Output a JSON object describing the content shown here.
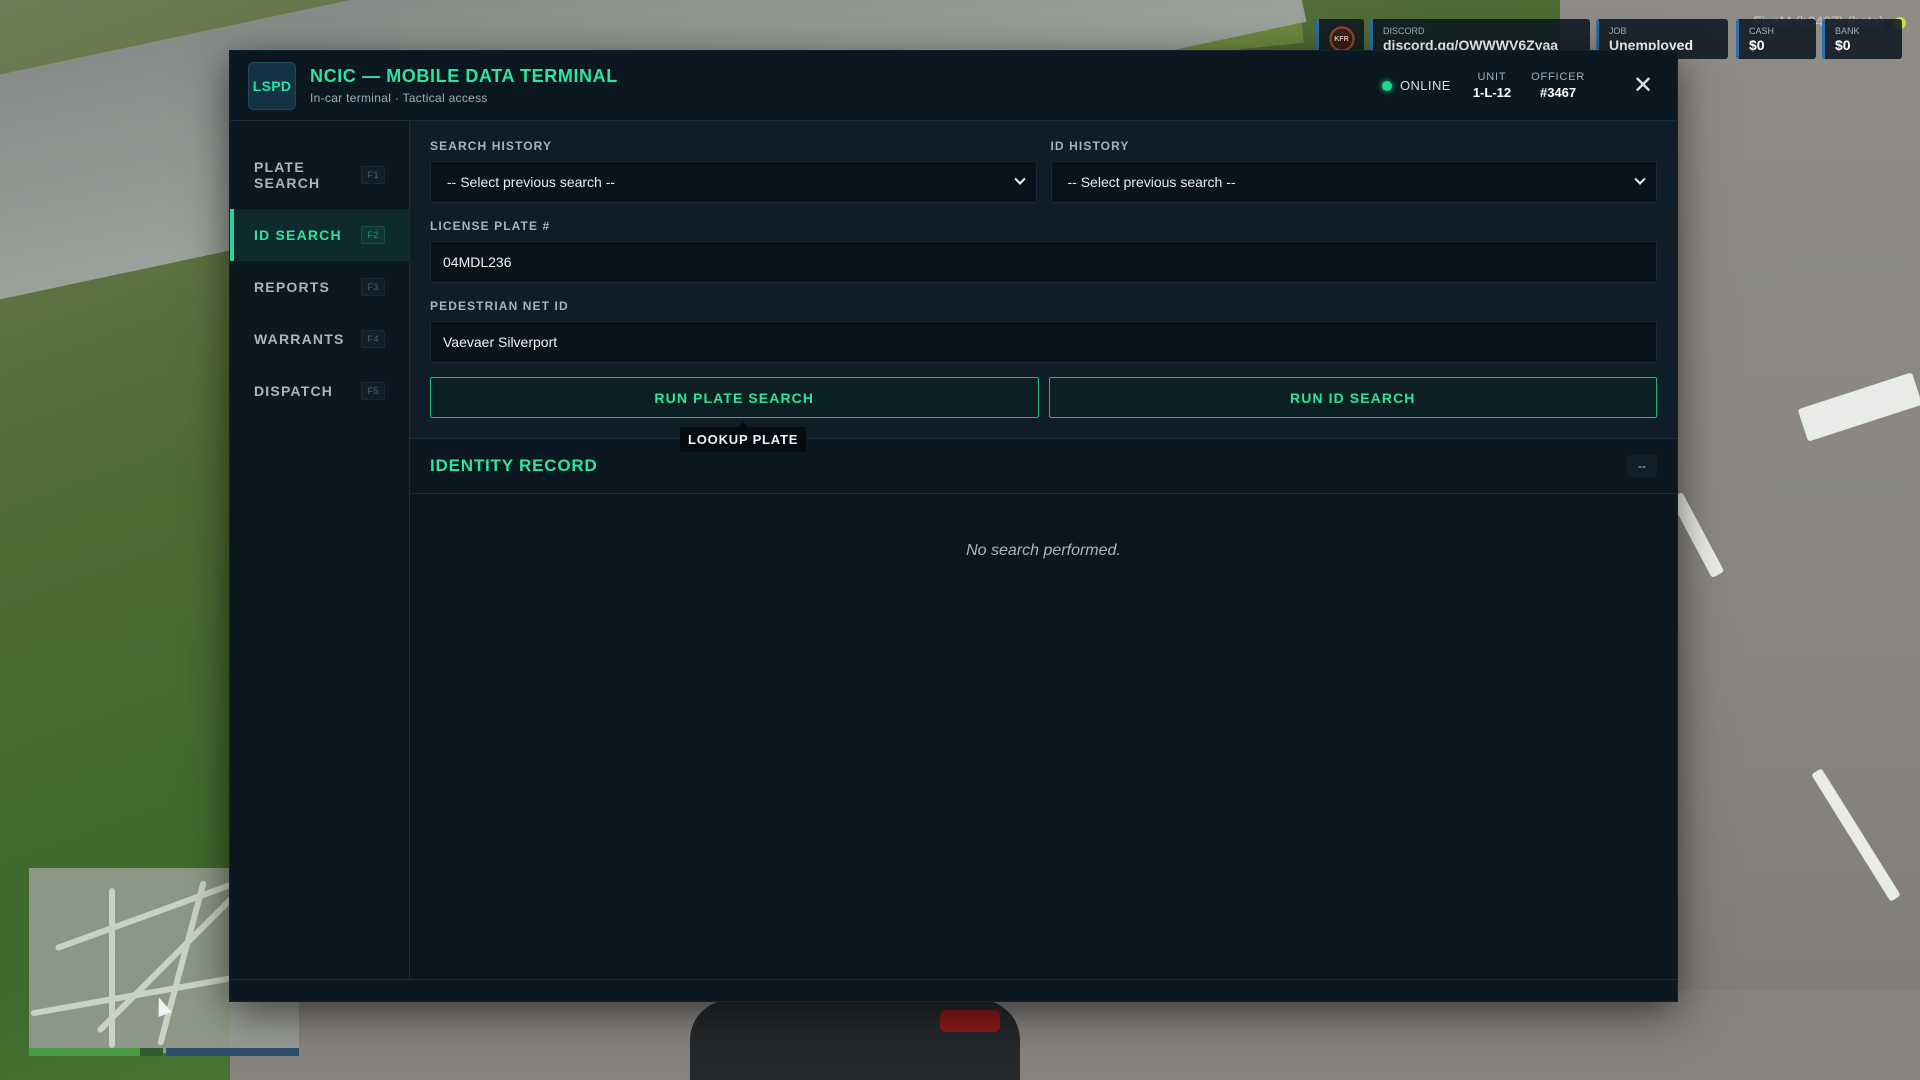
{
  "hud": {
    "logo_text": "KFR",
    "discord": {
      "label": "DISCORD",
      "value": "discord.gg/QWWWV6Zyaa"
    },
    "job": {
      "label": "JOB",
      "value": "Unemployed"
    },
    "cash": {
      "label": "CASH",
      "value": "$0"
    },
    "bank": {
      "label": "BANK",
      "value": "$0"
    },
    "status_text": "FiveM (b3407) (beta)"
  },
  "minimap": {
    "health_fraction": 0.83
  },
  "mdt": {
    "badge": "LSPD",
    "title": "NCIC — MOBILE DATA TERMINAL",
    "subtitle": "In-car terminal · Tactical access",
    "status": "ONLINE",
    "unit_label": "UNIT",
    "unit_value": "1-L-12",
    "officer_label": "OFFICER",
    "officer_value": "#3467",
    "close_glyph": "✕",
    "accent_color": "#2ee49e",
    "nav": [
      {
        "label": "PLATE SEARCH",
        "key": "F1"
      },
      {
        "label": "ID SEARCH",
        "key": "F2",
        "active": true
      },
      {
        "label": "REPORTS",
        "key": "F3"
      },
      {
        "label": "WARRANTS",
        "key": "F4"
      },
      {
        "label": "DISPATCH",
        "key": "F5"
      }
    ],
    "form": {
      "search_history_label": "SEARCH HISTORY",
      "search_history_value": "-- Select previous search --",
      "id_history_label": "ID HISTORY",
      "id_history_value": "-- Select previous search --",
      "plate_label": "LICENSE PLATE #",
      "plate_value": "04MDL236",
      "ped_label": "PEDESTRIAN NET ID",
      "ped_value": "Vaevaer Silverport",
      "run_plate": "RUN PLATE SEARCH",
      "run_id": "RUN ID SEARCH",
      "tooltip": "LOOKUP PLATE"
    },
    "record": {
      "title": "IDENTITY RECORD",
      "collapse": "--",
      "empty": "No search performed."
    }
  }
}
